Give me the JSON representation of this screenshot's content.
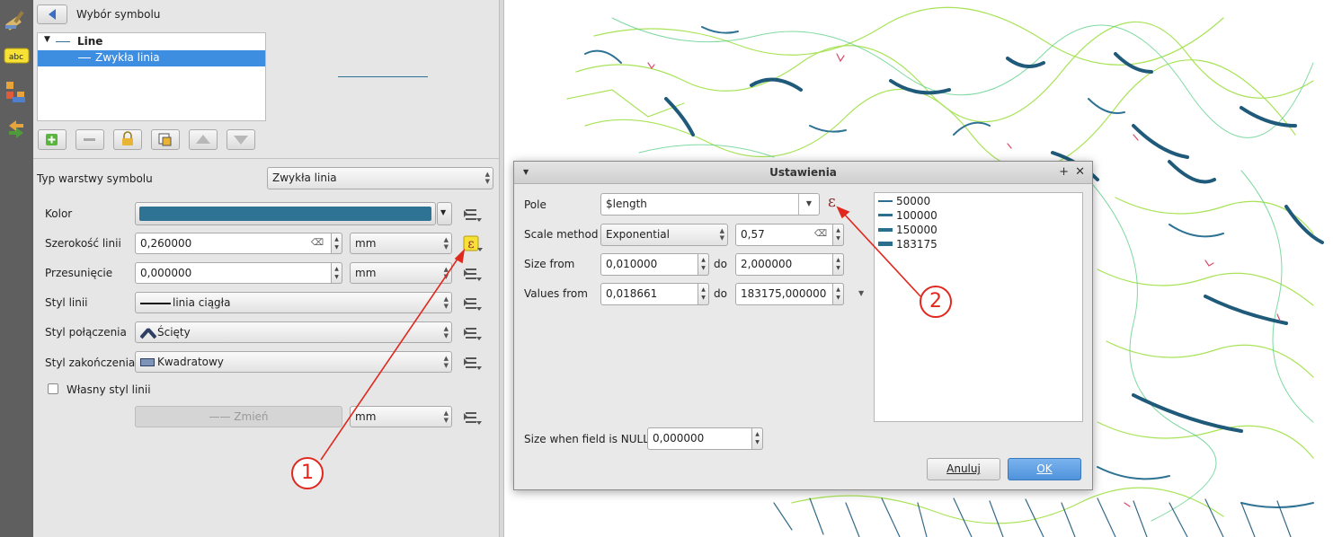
{
  "panel": {
    "header_title": "Wybór symbolu",
    "tree": {
      "root_label": "Line",
      "child_label": "Zwykła linia"
    },
    "symbol_layer_type_label": "Typ warstwy symbolu",
    "symbol_layer_type_value": "Zwykła linia",
    "rows": {
      "color_label": "Kolor",
      "width_label": "Szerokość linii",
      "width_value": "0,260000",
      "width_unit": "mm",
      "offset_label": "Przesunięcie",
      "offset_value": "0,000000",
      "offset_unit": "mm",
      "line_style_label": "Styl linii",
      "line_style_value": "linia ciągła",
      "join_style_label": "Styl połączenia",
      "join_style_value": "Ścięty",
      "cap_style_label": "Styl zakończenia",
      "cap_style_value": "Kwadratowy",
      "custom_dash_label": "Własny styl linii",
      "change_button": "Zmień",
      "change_unit": "mm"
    },
    "color_swatch": "#2e7294"
  },
  "dialog": {
    "title": "Ustawienia",
    "field_label": "Pole",
    "field_value": "$length",
    "scale_method_label": "Scale method",
    "scale_method_value": "Exponential",
    "exponent_value": "0,57",
    "size_from_label": "Size from",
    "size_from_value": "0,010000",
    "size_to_value": "2,000000",
    "values_from_label": "Values from",
    "values_from_value": "0,018661",
    "values_to_value": "183175,000000",
    "do_label": "do",
    "null_label": "Size when field is NULL",
    "null_value": "0,000000",
    "cancel_button": "Anuluj",
    "ok_button": "OK",
    "legend": [
      "50000",
      "100000",
      "150000",
      "183175"
    ],
    "legend_color": "#2b6f8e"
  },
  "callouts": [
    "1",
    "2"
  ],
  "colors": {
    "accent": "#3d8ee0",
    "callout": "#e0281e"
  }
}
